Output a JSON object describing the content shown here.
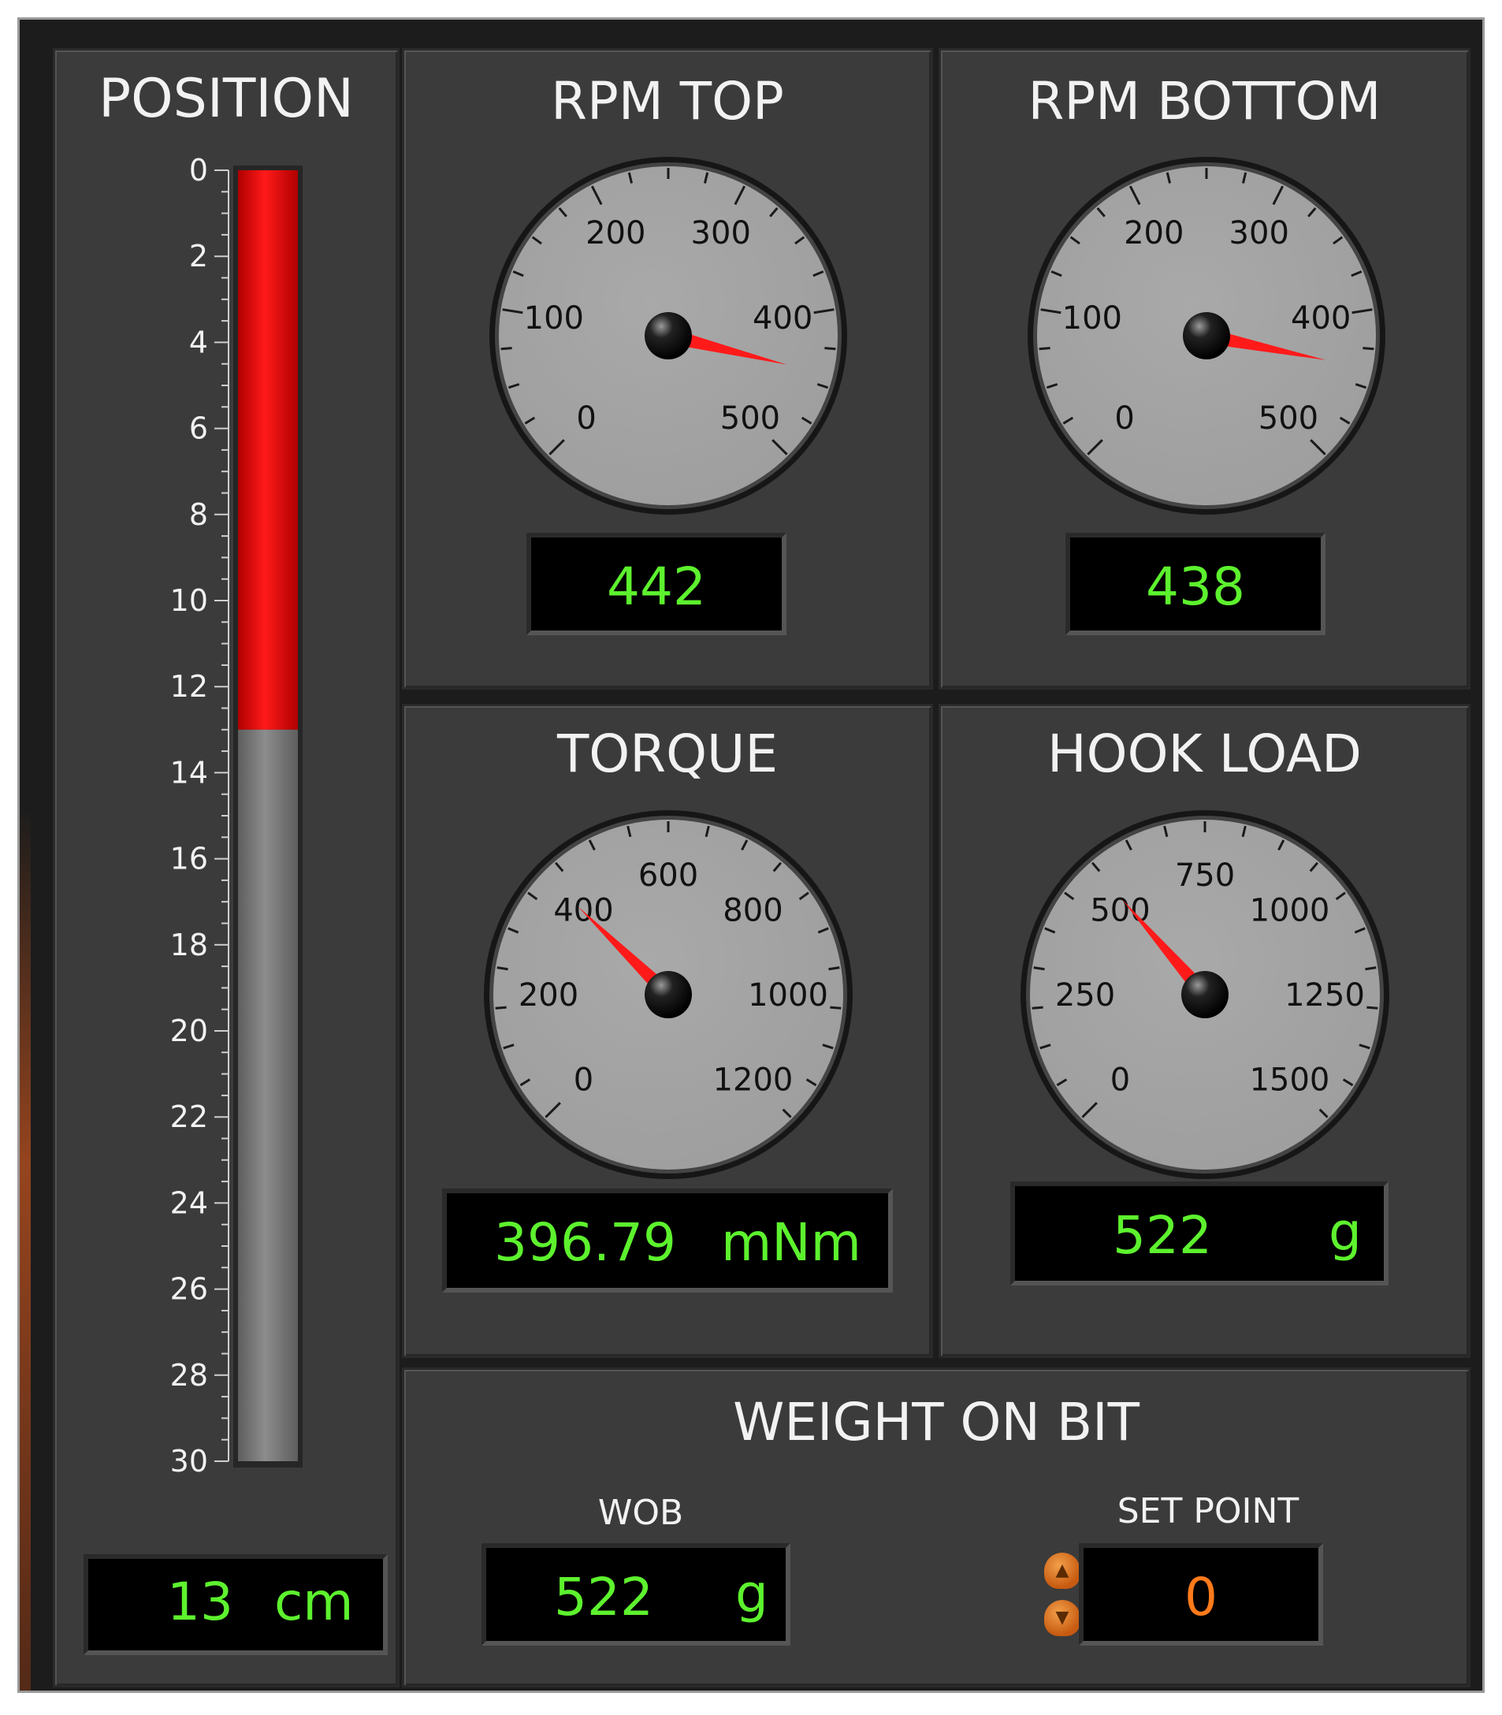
{
  "position": {
    "title": "POSITION",
    "tick_labels": [
      "0",
      "2",
      "4",
      "6",
      "8",
      "10",
      "12",
      "14",
      "16",
      "18",
      "20",
      "22",
      "24",
      "26",
      "28",
      "30"
    ],
    "scale_min": 0,
    "scale_max": 30,
    "value": 13,
    "unit": "cm",
    "fill_color": "#ff1a1a",
    "empty_color": "#8c8c8c"
  },
  "rpm_top": {
    "title": "RPM TOP",
    "dial_labels": [
      "0",
      "100",
      "200",
      "300",
      "400",
      "500"
    ],
    "value": "442",
    "needle_value": 442
  },
  "rpm_bottom": {
    "title": "RPM BOTTOM",
    "dial_labels": [
      "0",
      "100",
      "200",
      "300",
      "400",
      "500"
    ],
    "value": "438",
    "needle_value": 438
  },
  "torque": {
    "title": "TORQUE",
    "dial_labels": [
      "0",
      "200",
      "400",
      "600",
      "800",
      "1000",
      "1200"
    ],
    "value": "396.79",
    "unit": "mNm",
    "needle_value": 396.79
  },
  "hook_load": {
    "title": "HOOK LOAD",
    "dial_labels": [
      "0",
      "250",
      "500",
      "750",
      "1000",
      "1250",
      "1500"
    ],
    "value": "522",
    "unit": "g",
    "needle_value": 522
  },
  "weight_on_bit": {
    "title": "WEIGHT ON BIT",
    "wob_label": "WOB",
    "wob_value": "522",
    "wob_unit": "g",
    "setpoint_label": "SET POINT",
    "setpoint_value": "0",
    "setpoint_color": "#ff7a1a"
  },
  "colors": {
    "display_text": "#5df22e",
    "needle": "#ff1a1a",
    "dial_face": "#9e9e9e"
  },
  "icons": {
    "increment": "triangle-up-icon",
    "decrement": "triangle-down-icon"
  }
}
